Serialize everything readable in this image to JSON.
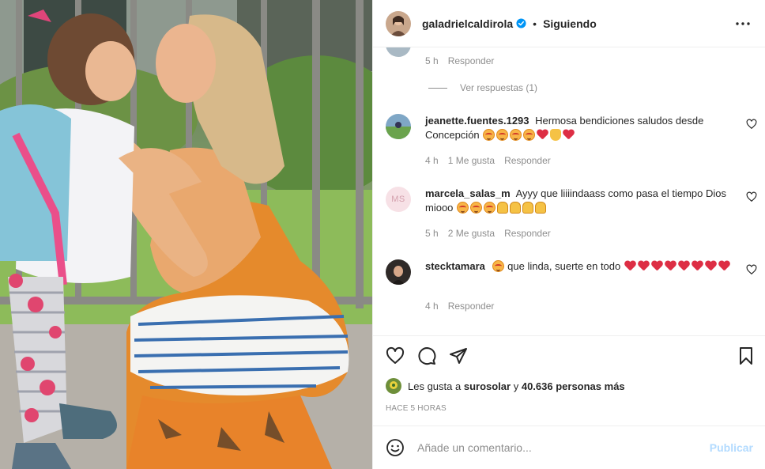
{
  "header": {
    "username": "galadrielcaldirola",
    "separator": "•",
    "follow_status": "Siguiendo",
    "icons": {
      "avatar": "avatar-photo",
      "verified": "verified-badge-icon",
      "more": "more-horizontal-icon"
    }
  },
  "top_comment_meta": {
    "time": "5 h",
    "reply": "Responder"
  },
  "view_replies": "Ver respuestas (1)",
  "comments": [
    {
      "username": "jeanette.fuentes.1293",
      "text": "Hermosa bendiciones saludos desde Concepción",
      "time": "4 h",
      "likes": "1 Me gusta",
      "reply": "Responder"
    },
    {
      "username": "marcela_salas_m",
      "avatar_initials": "MS",
      "text": "Ayyy que liiiindaass como pasa el tiempo Dios miooo",
      "time": "5 h",
      "likes": "2 Me gusta",
      "reply": "Responder"
    },
    {
      "username": "stecktamara",
      "text": "que linda, suerte en todo",
      "time": "4 h",
      "reply": "Responder"
    }
  ],
  "likes_line": {
    "prefix": "Les gusta a",
    "user": "surosolar",
    "connector": "y",
    "count": "40.636 personas más"
  },
  "posted_ago": "HACE 5 HORAS",
  "add_comment": {
    "placeholder": "Añade un comentario...",
    "post_label": "Publicar"
  },
  "colors": {
    "text": "#262626",
    "muted": "#8e8e8e",
    "border": "#efefef",
    "verified": "#0095f6",
    "post_disabled": "#b3dbff",
    "heart_emoji": "#dd2e44"
  }
}
